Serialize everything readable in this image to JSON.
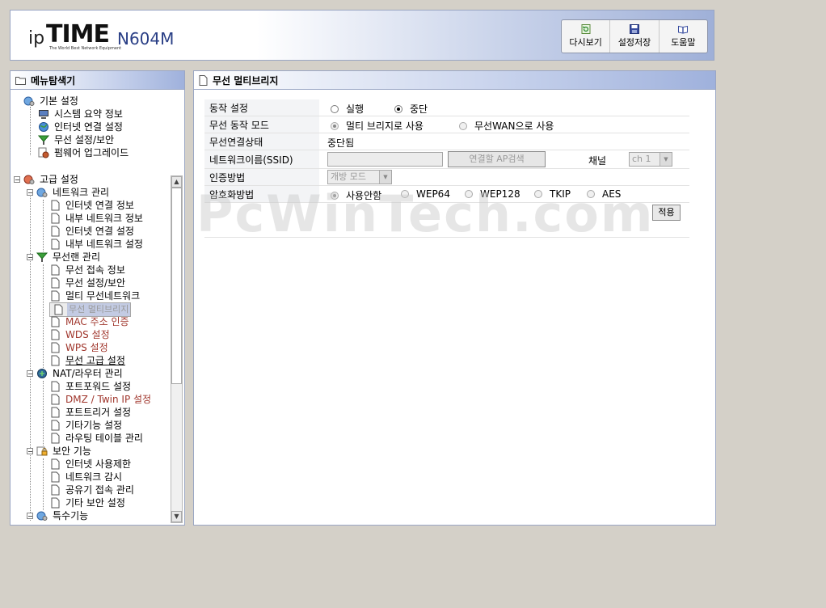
{
  "header": {
    "logo_ip": "ip",
    "logo_time": "TIME",
    "logo_tagline": "The World Best Network Equipment",
    "model": "N604M",
    "buttons": [
      {
        "label": "다시보기",
        "icon": "refresh-icon"
      },
      {
        "label": "설정저장",
        "icon": "save-icon"
      },
      {
        "label": "도움말",
        "icon": "book-icon"
      }
    ]
  },
  "sidebar": {
    "title": "메뉴탐색기",
    "basic": {
      "label": "기본 설정",
      "items": [
        "시스템 요약 정보",
        "인터넷 연결 설정",
        "무선 설정/보안",
        "펌웨어 업그레이드"
      ]
    },
    "advanced": {
      "label": "고급 설정",
      "groups": [
        {
          "label": "네트워크 관리",
          "items": [
            "인터넷 연결 정보",
            "내부 네트워크 정보",
            "인터넷 연결 설정",
            "내부 네트워크 설정"
          ]
        },
        {
          "label": "무선랜 관리",
          "items": [
            "무선 접속 정보",
            "무선 설정/보안",
            "멀티 무선네트워크",
            "무선 멀티브리지",
            "MAC 주소 인증",
            "WDS 설정",
            "WPS 설정",
            "무선 고급 설정"
          ]
        },
        {
          "label": "NAT/라우터 관리",
          "items": [
            "포트포워드 설정",
            "DMZ / Twin IP 설정",
            "포트트리거 설정",
            "기타기능 설정",
            "라우팅 테이블 관리"
          ]
        },
        {
          "label": "보안 기능",
          "items": [
            "인터넷 사용제한",
            "네트워크 감시",
            "공유기 접속 관리",
            "기타 보안 설정"
          ]
        },
        {
          "label": "특수기능",
          "items": []
        }
      ]
    }
  },
  "main": {
    "title": "무선 멀티브리지",
    "rows": {
      "operation": {
        "label": "동작 설정",
        "opt1": "실행",
        "opt2": "중단"
      },
      "mode": {
        "label": "무선 동작 모드",
        "opt1": "멀티 브리지로 사용",
        "opt2": "무선WAN으로 사용"
      },
      "status": {
        "label": "무선연결상태",
        "value": "중단됨"
      },
      "ssid": {
        "label": "네트워크이름(SSID)",
        "value": "",
        "search_button": "연결할 AP검색",
        "channel_label": "채널",
        "channel_value": "ch 1"
      },
      "auth": {
        "label": "인증방법",
        "value": "개방 모드"
      },
      "encryption": {
        "label": "암호화방법",
        "options": [
          "사용안함",
          "WEP64",
          "WEP128",
          "TKIP",
          "AES"
        ]
      }
    },
    "apply_button": "적용"
  },
  "watermark": "PcWinTech.com"
}
